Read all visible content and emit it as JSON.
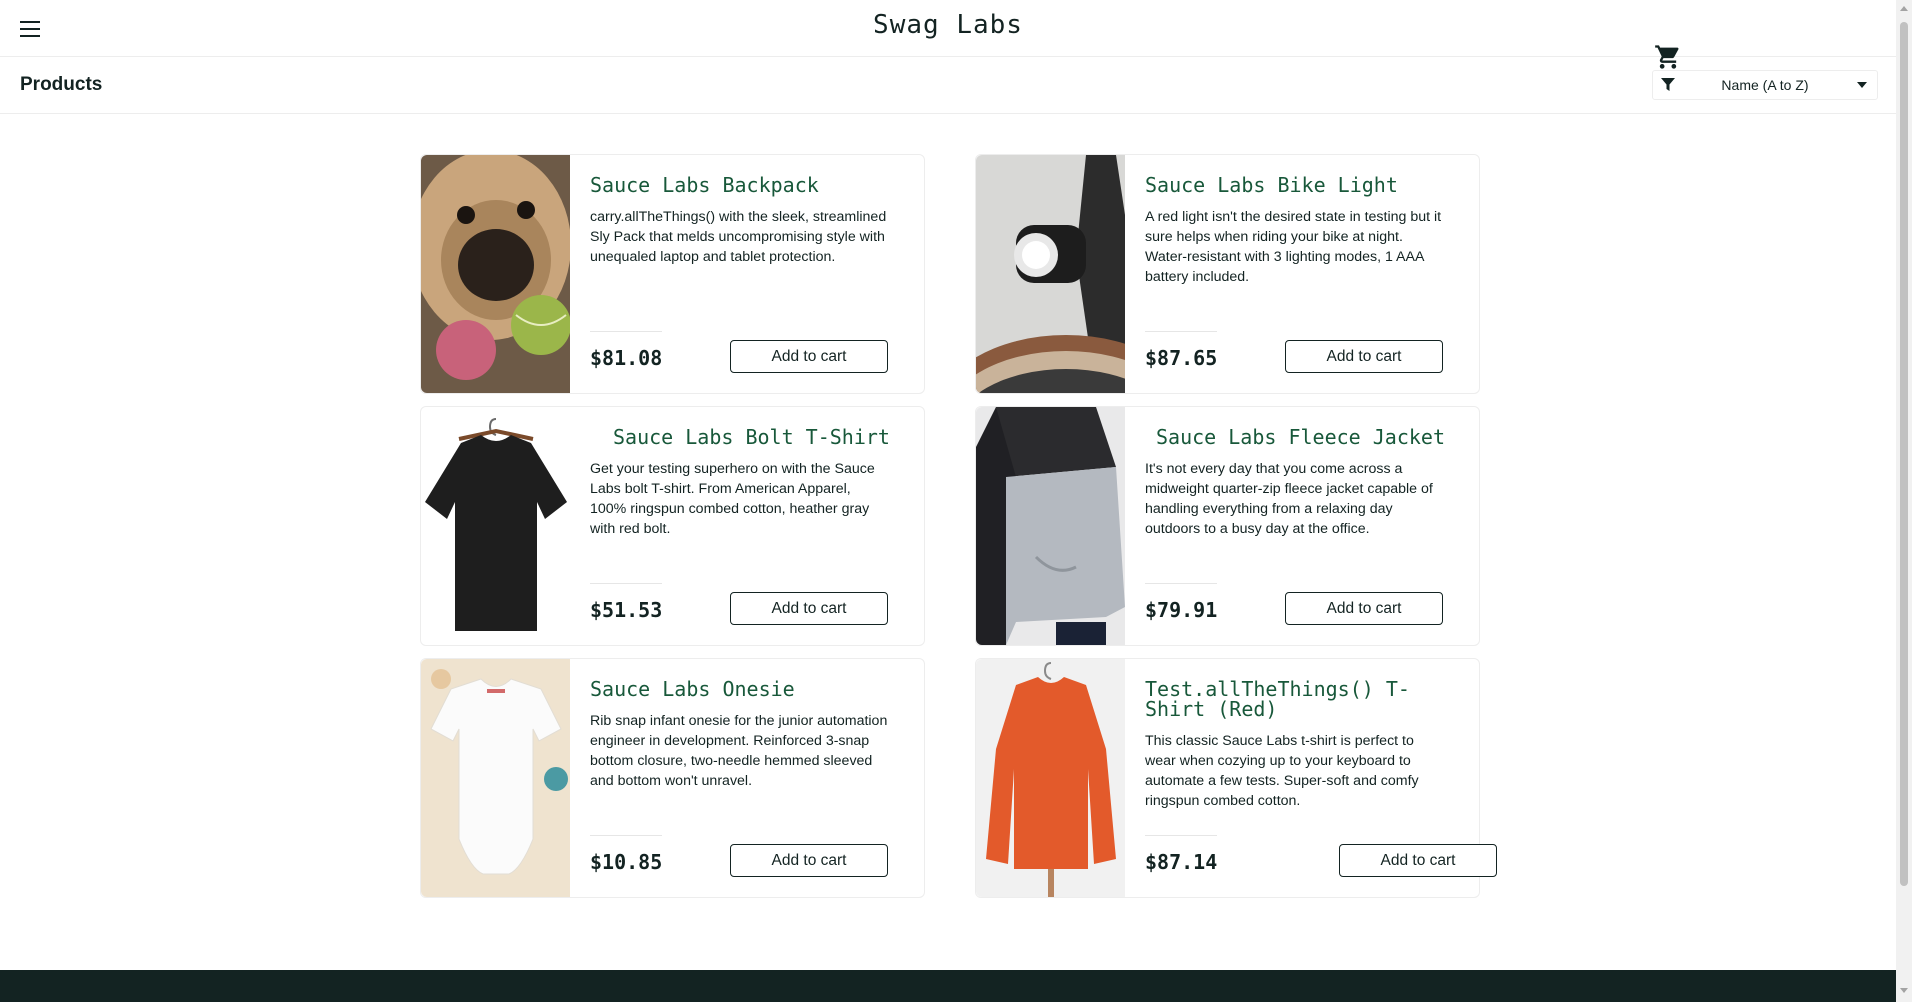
{
  "header": {
    "app_title": "Swag Labs",
    "menu_icon": "hamburger-menu-icon",
    "cart_icon": "shopping-cart-icon"
  },
  "subheader": {
    "title": "Products",
    "sort_icon": "filter-icon",
    "sort_selected": "Name (A to Z)"
  },
  "products": [
    {
      "name": "Sauce Labs Backpack",
      "description": "carry.allTheThings() with the sleek, streamlined Sly Pack that melds uncompromising style with unequaled laptop and tablet protection.",
      "price": "$81.08",
      "button": "Add to cart"
    },
    {
      "name": "Sauce Labs Bike Light",
      "description": "A red light isn't the desired state in testing but it sure helps when riding your bike at night. Water-resistant with 3 lighting modes, 1 AAA battery included.",
      "price": "$87.65",
      "button": "Add to cart"
    },
    {
      "name": "Sauce Labs Bolt T-Shirt",
      "description": "Get your testing superhero on with the Sauce Labs bolt T-shirt. From American Apparel, 100% ringspun combed cotton, heather gray with red bolt.",
      "price": "$51.53",
      "button": "Add to cart"
    },
    {
      "name": "Sauce Labs Fleece Jacket",
      "description": "It's not every day that you come across a midweight quarter-zip fleece jacket capable of handling everything from a relaxing day outdoors to a busy day at the office.",
      "price": "$79.91",
      "button": "Add to cart"
    },
    {
      "name": "Sauce Labs Onesie",
      "description": "Rib snap infant onesie for the junior automation engineer in development. Reinforced 3-snap bottom closure, two-needle hemmed sleeved and bottom won't unravel.",
      "price": "$10.85",
      "button": "Add to cart"
    },
    {
      "name": "Test.allTheThings() T-Shirt (Red)",
      "description": "This classic Sauce Labs t-shirt is perfect to wear when cozying up to your keyboard to automate a few tests. Super-soft and comfy ringspun combed cotton.",
      "price": "$87.14",
      "button": "Add to cart"
    }
  ],
  "colors": {
    "brand_dark": "#132322",
    "product_name": "#18583a",
    "border": "#ededed"
  }
}
